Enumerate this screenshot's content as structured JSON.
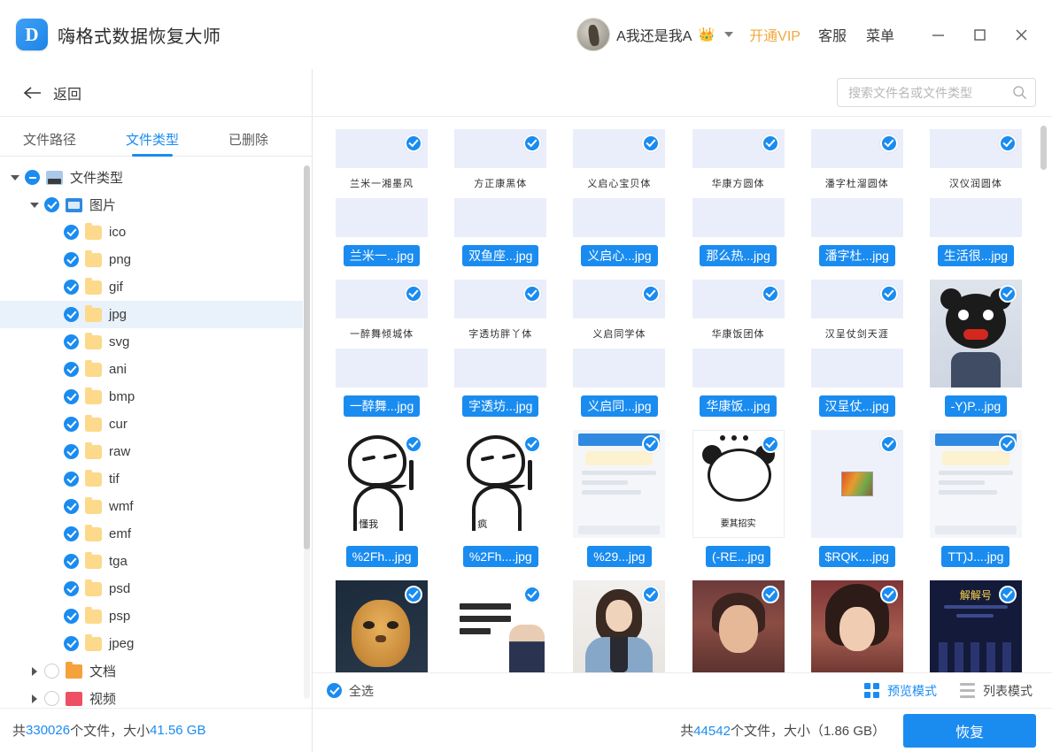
{
  "titlebar": {
    "app_title": "嗨格式数据恢复大师",
    "logo_glyph": "D",
    "user_name": "A我还是我A",
    "crown_glyph": "👑",
    "vip_label": "开通VIP",
    "support_label": "客服",
    "menu_label": "菜单",
    "minimize_label": "最小化",
    "maximize_label": "最大化",
    "close_label": "关闭"
  },
  "left": {
    "back_label": "返回",
    "tabs": [
      {
        "label": "文件路径",
        "active": false
      },
      {
        "label": "文件类型",
        "active": true
      },
      {
        "label": "已删除",
        "active": false
      }
    ],
    "tree": [
      {
        "label": "文件类型",
        "depth": 0,
        "state": "partial",
        "icon": "root",
        "expander": "open"
      },
      {
        "label": "图片",
        "depth": 1,
        "state": "checked",
        "icon": "pic",
        "expander": "open"
      },
      {
        "label": "ico",
        "depth": 2,
        "state": "checked",
        "icon": "folder",
        "expander": "none"
      },
      {
        "label": "png",
        "depth": 2,
        "state": "checked",
        "icon": "folder",
        "expander": "none"
      },
      {
        "label": "gif",
        "depth": 2,
        "state": "checked",
        "icon": "folder",
        "expander": "none"
      },
      {
        "label": "jpg",
        "depth": 2,
        "state": "checked",
        "icon": "folder",
        "expander": "none",
        "selected": true
      },
      {
        "label": "svg",
        "depth": 2,
        "state": "checked",
        "icon": "folder",
        "expander": "none"
      },
      {
        "label": "ani",
        "depth": 2,
        "state": "checked",
        "icon": "folder",
        "expander": "none"
      },
      {
        "label": "bmp",
        "depth": 2,
        "state": "checked",
        "icon": "folder",
        "expander": "none"
      },
      {
        "label": "cur",
        "depth": 2,
        "state": "checked",
        "icon": "folder",
        "expander": "none"
      },
      {
        "label": "raw",
        "depth": 2,
        "state": "checked",
        "icon": "folder",
        "expander": "none"
      },
      {
        "label": "tif",
        "depth": 2,
        "state": "checked",
        "icon": "folder",
        "expander": "none"
      },
      {
        "label": "wmf",
        "depth": 2,
        "state": "checked",
        "icon": "folder",
        "expander": "none"
      },
      {
        "label": "emf",
        "depth": 2,
        "state": "checked",
        "icon": "folder",
        "expander": "none"
      },
      {
        "label": "tga",
        "depth": 2,
        "state": "checked",
        "icon": "folder",
        "expander": "none"
      },
      {
        "label": "psd",
        "depth": 2,
        "state": "checked",
        "icon": "folder",
        "expander": "none"
      },
      {
        "label": "psp",
        "depth": 2,
        "state": "checked",
        "icon": "folder",
        "expander": "none"
      },
      {
        "label": "jpeg",
        "depth": 2,
        "state": "checked",
        "icon": "folder",
        "expander": "none"
      },
      {
        "label": "文档",
        "depth": 1,
        "state": "empty",
        "icon": "folder-orange",
        "expander": "closed"
      },
      {
        "label": "视频",
        "depth": 1,
        "state": "empty",
        "icon": "redish",
        "expander": "closed"
      }
    ],
    "status": {
      "prefix": "共",
      "file_count": "330026",
      "middle": "个文件，大小",
      "size": "41.56 GB"
    }
  },
  "search": {
    "placeholder": "搜索文件名或文件类型",
    "value": ""
  },
  "grid": {
    "items": [
      {
        "name": "兰米一...jpg",
        "thumb": "font",
        "preview_text": "兰米一湘墨风"
      },
      {
        "name": "双鱼座...jpg",
        "thumb": "font",
        "preview_text": "方正康黑体"
      },
      {
        "name": "义启心...jpg",
        "thumb": "font",
        "preview_text": "义启心宝贝体"
      },
      {
        "name": "那么热...jpg",
        "thumb": "font",
        "preview_text": "华康方圆体"
      },
      {
        "name": "潘字杜...jpg",
        "thumb": "font",
        "preview_text": "潘字杜溜圆体"
      },
      {
        "name": "生活很...jpg",
        "thumb": "font",
        "preview_text": "汉仪润圆体"
      },
      {
        "name": "一醉舞...jpg",
        "thumb": "font",
        "preview_text": "一醉舞倾城体"
      },
      {
        "name": "字透坊...jpg",
        "thumb": "font",
        "preview_text": "字透坊胖丫体"
      },
      {
        "name": "义启同...jpg",
        "thumb": "font",
        "preview_text": "义启同学体"
      },
      {
        "name": "华康饭...jpg",
        "thumb": "font",
        "preview_text": "华康饭团体"
      },
      {
        "name": "汉呈仗...jpg",
        "thumb": "font",
        "preview_text": "汉呈仗剑天涯"
      },
      {
        "name": "-Y)P...jpg",
        "thumb": "panda-photo",
        "preview_text": ""
      },
      {
        "name": "%2Fh...jpg",
        "thumb": "meme",
        "preview_text": "懂我"
      },
      {
        "name": "%2Fh....jpg",
        "thumb": "meme",
        "preview_text": "疯"
      },
      {
        "name": "%29...jpg",
        "thumb": "chat",
        "preview_text": ""
      },
      {
        "name": "(-RE...jpg",
        "thumb": "panda",
        "preview_text": "要其招实"
      },
      {
        "name": "$RQK....jpg",
        "thumb": "small-pic",
        "preview_text": ""
      },
      {
        "name": "TT)J....jpg",
        "thumb": "chat",
        "preview_text": ""
      },
      {
        "name": "",
        "thumb": "cat",
        "preview_text": ""
      },
      {
        "name": "",
        "thumb": "doc-person",
        "preview_text": ""
      },
      {
        "name": "",
        "thumb": "girl1",
        "preview_text": ""
      },
      {
        "name": "",
        "thumb": "girl2",
        "preview_text": ""
      },
      {
        "name": "",
        "thumb": "girl3",
        "preview_text": ""
      },
      {
        "name": "",
        "thumb": "poster",
        "preview_text": "解解号"
      }
    ]
  },
  "viewbar": {
    "select_all_label": "全选",
    "preview_mode_label": "预览模式",
    "list_mode_label": "列表模式",
    "active_mode": "preview"
  },
  "right_status": {
    "prefix": "共",
    "file_count": "44542",
    "middle": "个文件，大小",
    "size": "（1.86 GB）",
    "recover_label": "恢复"
  },
  "colors": {
    "accent": "#1a8cf0",
    "vip": "#f0a93c",
    "folder": "#fcd98b"
  }
}
